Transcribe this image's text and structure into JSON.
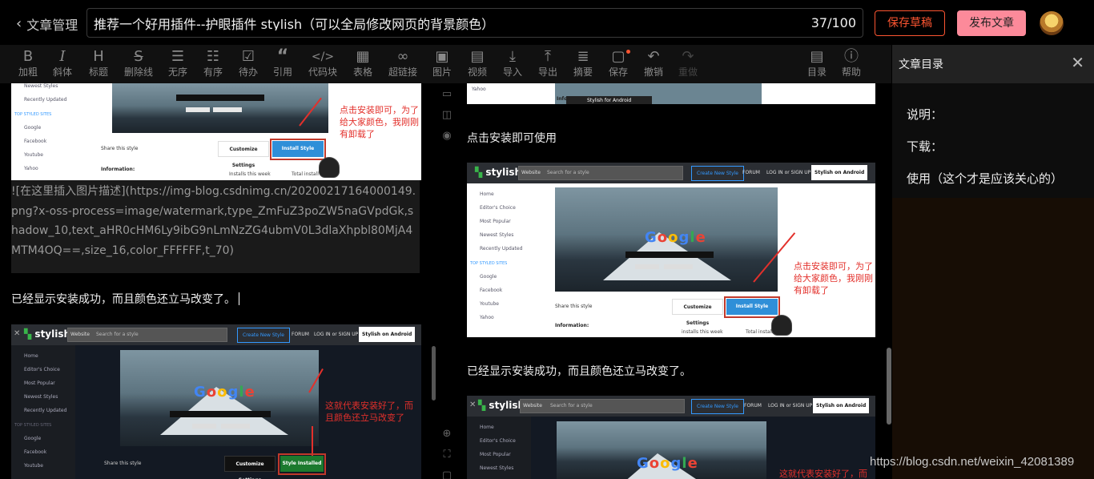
{
  "header": {
    "back_label": "文章管理",
    "title_value": "推荐一个好用插件--护眼插件 stylish（可以全局修改网页的背景颜色）",
    "title_count": "37/100",
    "save_draft": "保存草稿",
    "publish": "发布文章"
  },
  "toolbar": {
    "items": [
      {
        "label": "加粗",
        "icon": "bold-icon"
      },
      {
        "label": "斜体",
        "icon": "italic-icon"
      },
      {
        "label": "标题",
        "icon": "heading-icon"
      },
      {
        "label": "删除线",
        "icon": "strikethrough-icon"
      },
      {
        "label": "无序",
        "icon": "unordered-list-icon"
      },
      {
        "label": "有序",
        "icon": "ordered-list-icon"
      },
      {
        "label": "待办",
        "icon": "todo-list-icon"
      },
      {
        "label": "引用",
        "icon": "quote-icon"
      },
      {
        "label": "代码块",
        "icon": "code-icon"
      },
      {
        "label": "表格",
        "icon": "table-icon"
      },
      {
        "label": "超链接",
        "icon": "link-icon"
      },
      {
        "label": "图片",
        "icon": "image-icon"
      },
      {
        "label": "视频",
        "icon": "video-icon"
      },
      {
        "label": "导入",
        "icon": "import-icon"
      },
      {
        "label": "导出",
        "icon": "export-icon"
      },
      {
        "label": "摘要",
        "icon": "summary-icon"
      },
      {
        "label": "保存",
        "icon": "save-icon"
      },
      {
        "label": "撤销",
        "icon": "undo-icon"
      },
      {
        "label": "重做",
        "icon": "redo-icon"
      },
      {
        "label": "目录",
        "icon": "toc-icon"
      },
      {
        "label": "帮助",
        "icon": "help-icon"
      }
    ]
  },
  "editor": {
    "shot1": {
      "red_note": "点击安装即可，为了给大家颜色，我刚刚有卸载了",
      "share": "Share this style",
      "customize": "Customize Settings",
      "install": "Install Style",
      "information": "Information:",
      "installs": "Installs this week",
      "total": "Total install",
      "side": [
        "Newest Styles",
        "Recently Updated"
      ],
      "side_head": "TOP STYLED SITES",
      "sites": [
        "Google",
        "Facebook",
        "Youtube",
        "Yahoo"
      ]
    },
    "markdown_image": "![在这里插入图片描述](https://img-blog.csdnimg.cn/20200217164000149.png?x-oss-process=image/watermark,type_ZmFuZ3poZW5naGVpdGk,shadow_10,text_aHR0cHM6Ly9ibG9nLmNzZG4ubmV0L3dlaXhpbl80MjA4MTM4OQ==,size_16,color_FFFFFF,t_70)",
    "success_line": "已经显示安装成功，而且颜色还立马改变了。",
    "shot2": {
      "logo": "stylish",
      "website": "Website",
      "search": "Search for a style",
      "create": "Create New Style",
      "forum": "FORUM",
      "login": "LOG IN or SIGN UP",
      "android": "Stylish on Android",
      "side": [
        "Home",
        "Editor's Choice",
        "Most Popular",
        "Newest Styles",
        "Recently Updated"
      ],
      "side_head": "TOP STYLED SITES",
      "sites": [
        "Google",
        "Facebook",
        "Youtube"
      ],
      "red_note": "这就代表安装好了，而且颜色还立马改变了",
      "share": "Share this style",
      "customize": "Customize Settings",
      "installed": "Style Installed"
    }
  },
  "preview": {
    "shot0": {
      "information": "Information:",
      "banner": "Stylish for Android",
      "site": "Yahoo"
    },
    "text1": "点击安装即可使用",
    "shot1": {
      "logo": "stylish",
      "website": "Website",
      "search": "Search for a style",
      "create": "Create New Style",
      "forum": "FORUM",
      "login": "LOG IN or SIGN UP",
      "android": "Stylish on Android",
      "side": [
        "Home",
        "Editor's Choice",
        "Most Popular",
        "Newest Styles",
        "Recently Updated"
      ],
      "side_head": "TOP STYLED SITES",
      "sites": [
        "Google",
        "Facebook",
        "Youtube",
        "Yahoo"
      ],
      "red_note": "点击安装即可，为了给大家颜色，我刚刚有卸载了",
      "share": "Share this style",
      "customize": "Customize Settings",
      "install": "Install Style",
      "information": "Information:",
      "installs": "installs this week",
      "total": "Total install"
    },
    "text2": "已经显示安装成功，而且颜色还立马改变了。",
    "shot2": {
      "logo": "stylish",
      "website": "Website",
      "search": "Search for a style",
      "create": "Create New Style",
      "forum": "FORUM",
      "login": "LOG IN or SIGN UP",
      "android": "Stylish on Android",
      "side": [
        "Home",
        "Editor's Choice",
        "Most Popular",
        "Newest Styles"
      ],
      "red_note": "这就代表安装好了，而"
    }
  },
  "toc": {
    "title": "文章目录",
    "items": [
      "说明：",
      "下载：",
      "使用（这个才是应该关心的）"
    ]
  },
  "watermark": "https://blog.csdn.net/weixin_42081389",
  "colors": {
    "accent": "#fc5531",
    "publish_bg": "#fc8a9a",
    "install_blue": "#2f8fd8",
    "annotation_red": "#e3302b"
  }
}
